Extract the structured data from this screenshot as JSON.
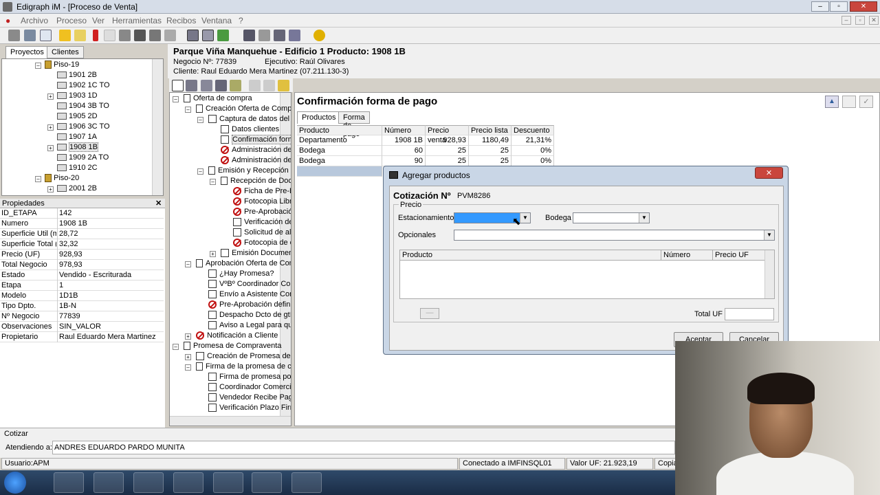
{
  "window": {
    "title": "Edigraph iM - [Proceso de Venta]",
    "controls": [
      "–",
      "▫",
      "✕"
    ]
  },
  "menu": [
    "Archivo",
    "Proceso",
    "Ver",
    "Herramientas",
    "Recibos",
    "Ventana",
    "?"
  ],
  "left_tabs": [
    "Proyectos",
    "Clientes"
  ],
  "project_tree": [
    {
      "label": "Piso-19",
      "type": "floor",
      "level": 0
    },
    {
      "label": "1901 2B",
      "type": "unit",
      "level": 1
    },
    {
      "label": "1902 1C TO",
      "type": "unit",
      "level": 1
    },
    {
      "label": "1903 1D",
      "type": "unit",
      "level": 1,
      "expandable": true
    },
    {
      "label": "1904 3B TO",
      "type": "unit",
      "level": 1
    },
    {
      "label": "1905 2D",
      "type": "unit",
      "level": 1
    },
    {
      "label": "1906 3C TO",
      "type": "unit",
      "level": 1,
      "expandable": true
    },
    {
      "label": "1907 1A",
      "type": "unit",
      "level": 1
    },
    {
      "label": "1908 1B",
      "type": "unit",
      "level": 1,
      "expandable": true,
      "selected": true
    },
    {
      "label": "1909 2A TO",
      "type": "unit",
      "level": 1
    },
    {
      "label": "1910 2C",
      "type": "unit",
      "level": 1
    },
    {
      "label": "Piso-20",
      "type": "floor",
      "level": 0
    },
    {
      "label": "2001 2B",
      "type": "unit",
      "level": 1,
      "expandable": true
    }
  ],
  "properties": {
    "title": "Propiedades",
    "rows": [
      [
        "ID_ETAPA",
        "142"
      ],
      [
        "Numero",
        "1908 1B"
      ],
      [
        "Superficie Util (m.",
        "28,72"
      ],
      [
        "Superficie Total (",
        "32,32"
      ],
      [
        "Precio (UF)",
        "928,93"
      ],
      [
        "Total Negocio",
        "978,93"
      ],
      [
        "Estado",
        "Vendido - Escriturada"
      ],
      [
        "Etapa",
        "1"
      ],
      [
        "Modelo",
        "1D1B"
      ],
      [
        "Tipo Dpto.",
        "1B-N"
      ],
      [
        "Nº Negocio",
        "77839"
      ],
      [
        "Observaciones",
        "SIN_VALOR"
      ],
      [
        "Propietario",
        "Raul Eduardo Mera Martinez"
      ]
    ]
  },
  "header": {
    "title": "Parque Viña Manquehue - Edificio 1 Producto: 1908 1B",
    "negocio": "Negocio Nº: 77839",
    "ejecutivo": "Ejecutivo: Raúl Olivares",
    "cliente": "Cliente: Raul Eduardo Mera Martinez (07.211.130-3)"
  },
  "process_tree": [
    {
      "label": "Oferta de compra",
      "icon": "doc",
      "indent": 0,
      "exp": "-"
    },
    {
      "label": "Creación Oferta de Compra",
      "icon": "doc",
      "indent": 1,
      "exp": "-"
    },
    {
      "label": "Captura de datos del cc",
      "icon": "wf",
      "indent": 2,
      "exp": "-"
    },
    {
      "label": "Datos clientes",
      "icon": "wf",
      "indent": 3
    },
    {
      "label": "Confirmación forma",
      "icon": "wf",
      "indent": 3,
      "selected": true
    },
    {
      "label": "Administración de L",
      "icon": "no",
      "indent": 3
    },
    {
      "label": "Administración de S",
      "icon": "no",
      "indent": 3
    },
    {
      "label": "Emisión y Recepción de",
      "icon": "doc",
      "indent": 2,
      "exp": "-"
    },
    {
      "label": "Recepción de Docu",
      "icon": "doc",
      "indent": 3,
      "exp": "-"
    },
    {
      "label": "Ficha de Pre-Ev",
      "icon": "no",
      "indent": 4
    },
    {
      "label": "Fotocopia Libre",
      "icon": "no",
      "indent": 4
    },
    {
      "label": "Pre-Aprobación",
      "icon": "no",
      "indent": 4
    },
    {
      "label": "Verificación de",
      "icon": "wf",
      "indent": 4
    },
    {
      "label": "Solicitud de alg",
      "icon": "wf",
      "indent": 4
    },
    {
      "label": "Fotocopia de es",
      "icon": "no",
      "indent": 4
    },
    {
      "label": "Emisión Documentc",
      "icon": "wf",
      "indent": 3,
      "exp": "+"
    },
    {
      "label": "Aprobación Oferta de Comp",
      "icon": "doc",
      "indent": 1,
      "exp": "-"
    },
    {
      "label": "¿Hay Promesa?",
      "icon": "wf",
      "indent": 2
    },
    {
      "label": "VºBº Coordinador Come",
      "icon": "wf",
      "indent": 2
    },
    {
      "label": "Envío a Asistente Come",
      "icon": "wf",
      "indent": 2
    },
    {
      "label": "Pre-Aprobación definitiv",
      "icon": "no",
      "indent": 2
    },
    {
      "label": "Despacho Dcto de gtía",
      "icon": "wf",
      "indent": 2
    },
    {
      "label": "Aviso a Legal para que",
      "icon": "wf",
      "indent": 2
    },
    {
      "label": "Notificación a Cliente",
      "icon": "no",
      "indent": 1,
      "exp": "+"
    },
    {
      "label": "Promesa de Compraventa",
      "icon": "doc",
      "indent": 0,
      "exp": "-"
    },
    {
      "label": "Creación de Promesa de Cc",
      "icon": "wf",
      "indent": 1,
      "exp": "+"
    },
    {
      "label": "Firma de la promesa de com",
      "icon": "doc",
      "indent": 1,
      "exp": "-"
    },
    {
      "label": "Firma de promesa por c",
      "icon": "wf",
      "indent": 2
    },
    {
      "label": "Coordinador Comercial ε",
      "icon": "wf",
      "indent": 2
    },
    {
      "label": "Vendedor Recibe Pago",
      "icon": "wf",
      "indent": 2
    },
    {
      "label": "Verificación Plazo Firma",
      "icon": "wf",
      "indent": 2
    }
  ],
  "main": {
    "section_title": "Confirmación forma de pago",
    "tabs": [
      "Productos",
      "Forma de pago"
    ],
    "columns": [
      "Producto",
      "Número",
      "Precio venta",
      "Precio lista",
      "Descuento"
    ],
    "rows": [
      [
        "Departamento",
        "1908 1B",
        "928,93",
        "1180,49",
        "21,31%"
      ],
      [
        "Bodega",
        "60",
        "25",
        "25",
        "0%"
      ],
      [
        "Bodega",
        "90",
        "25",
        "25",
        "0%"
      ]
    ]
  },
  "dialog": {
    "title": "Agregar productos",
    "cotizacion_label": "Cotización Nº",
    "cotizacion_value": "PVM8286",
    "group_label": "Precio",
    "estacionamiento_label": "Estacionamiento",
    "bodega_label": "Bodega",
    "opcionales_label": "Opcionales",
    "columns": [
      "Producto",
      "Número",
      "Precio UF"
    ],
    "total_label": "Total UF",
    "aceptar": "Aceptar",
    "cancelar": "Cancelar",
    "close": "✕"
  },
  "bottom": {
    "cotizar": "Cotizar",
    "atendiendo_label": "Atendiendo a:",
    "atendiendo_value": "ANDRES EDUARDO PARDO MUNITA"
  },
  "status": {
    "usuario": "Usuario:APM",
    "conectado": "Conectado a IMFINSQL01",
    "valor_uf": "Valor UF: 21.923,19",
    "copiar": "Copiar"
  },
  "colors": {
    "selection": "#3399ff",
    "accent_blue": "#2f5f9e"
  }
}
